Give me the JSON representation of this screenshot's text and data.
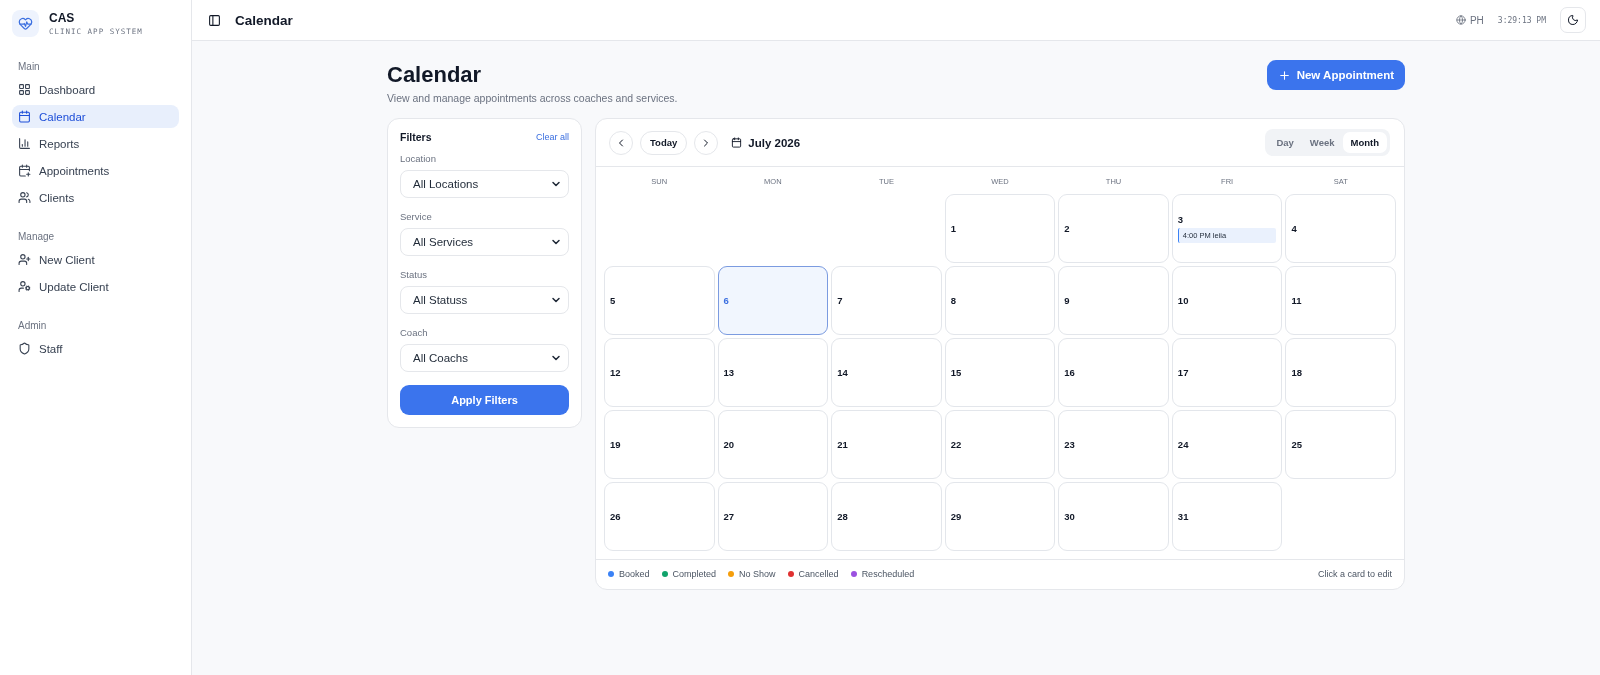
{
  "brand": {
    "name": "CAS",
    "tagline": "CLINIC APP SYSTEM"
  },
  "sidebar": {
    "sections": [
      {
        "title": "Main",
        "items": [
          {
            "label": "Dashboard",
            "selected": false
          },
          {
            "label": "Calendar",
            "selected": true
          },
          {
            "label": "Reports",
            "selected": false
          },
          {
            "label": "Appointments",
            "selected": false
          },
          {
            "label": "Clients",
            "selected": false
          }
        ]
      },
      {
        "title": "Manage",
        "items": [
          {
            "label": "New Client",
            "selected": false
          },
          {
            "label": "Update Client",
            "selected": false
          }
        ]
      },
      {
        "title": "Admin",
        "items": [
          {
            "label": "Staff",
            "selected": false
          }
        ]
      }
    ]
  },
  "topbar": {
    "title": "Calendar",
    "locale": "PH",
    "time": "3:29:13 PM"
  },
  "page": {
    "title": "Calendar",
    "subtitle": "View and manage appointments across coaches and services.",
    "primary_action": "New Appointment"
  },
  "filters": {
    "title": "Filters",
    "clear": "Clear all",
    "fields": [
      {
        "label": "Location",
        "value": "All Locations"
      },
      {
        "label": "Service",
        "value": "All Services"
      },
      {
        "label": "Status",
        "value": "All Statuss"
      },
      {
        "label": "Coach",
        "value": "All Coachs"
      }
    ],
    "apply": "Apply Filters"
  },
  "calendar": {
    "today": "Today",
    "month": "July 2026",
    "views": [
      {
        "label": "Day",
        "selected": false
      },
      {
        "label": "Week",
        "selected": false
      },
      {
        "label": "Month",
        "selected": true
      }
    ],
    "weekdays": [
      "SUN",
      "MON",
      "TUE",
      "WED",
      "THU",
      "FRI",
      "SAT"
    ],
    "weeks": [
      [
        {
          "kind": "blank"
        },
        {
          "kind": "blank"
        },
        {
          "kind": "blank"
        },
        {
          "kind": "day",
          "day": "1",
          "selected": false
        },
        {
          "kind": "day",
          "day": "2",
          "selected": false
        },
        {
          "kind": "day",
          "day": "3",
          "selected": false,
          "events": [
            {
              "text": "4:00 PM leiia",
              "color": "#3b82f6"
            }
          ]
        },
        {
          "kind": "day",
          "day": "4",
          "selected": false
        }
      ],
      [
        {
          "kind": "day",
          "day": "5",
          "selected": false
        },
        {
          "kind": "day",
          "day": "6",
          "selected": true
        },
        {
          "kind": "day",
          "day": "7",
          "selected": false
        },
        {
          "kind": "day",
          "day": "8",
          "selected": false
        },
        {
          "kind": "day",
          "day": "9",
          "selected": false
        },
        {
          "kind": "day",
          "day": "10",
          "selected": false
        },
        {
          "kind": "day",
          "day": "11",
          "selected": false
        }
      ],
      [
        {
          "kind": "day",
          "day": "12",
          "selected": false
        },
        {
          "kind": "day",
          "day": "13",
          "selected": false
        },
        {
          "kind": "day",
          "day": "14",
          "selected": false
        },
        {
          "kind": "day",
          "day": "15",
          "selected": false
        },
        {
          "kind": "day",
          "day": "16",
          "selected": false
        },
        {
          "kind": "day",
          "day": "17",
          "selected": false
        },
        {
          "kind": "day",
          "day": "18",
          "selected": false
        }
      ],
      [
        {
          "kind": "day",
          "day": "19",
          "selected": false
        },
        {
          "kind": "day",
          "day": "20",
          "selected": false
        },
        {
          "kind": "day",
          "day": "21",
          "selected": false
        },
        {
          "kind": "day",
          "day": "22",
          "selected": false
        },
        {
          "kind": "day",
          "day": "23",
          "selected": false
        },
        {
          "kind": "day",
          "day": "24",
          "selected": false
        },
        {
          "kind": "day",
          "day": "25",
          "selected": false
        }
      ],
      [
        {
          "kind": "day",
          "day": "26",
          "selected": false
        },
        {
          "kind": "day",
          "day": "27",
          "selected": false
        },
        {
          "kind": "day",
          "day": "28",
          "selected": false
        },
        {
          "kind": "day",
          "day": "29",
          "selected": false
        },
        {
          "kind": "day",
          "day": "30",
          "selected": false
        },
        {
          "kind": "day",
          "day": "31",
          "selected": false
        },
        {
          "kind": "blank"
        }
      ]
    ],
    "legend": [
      {
        "label": "Booked",
        "color": "#3b82f6"
      },
      {
        "label": "Completed",
        "color": "#10a36b"
      },
      {
        "label": "No Show",
        "color": "#f59e0b"
      },
      {
        "label": "Cancelled",
        "color": "#e03131"
      },
      {
        "label": "Rescheduled",
        "color": "#9b51e0"
      }
    ],
    "hint": "Click a card to edit"
  }
}
